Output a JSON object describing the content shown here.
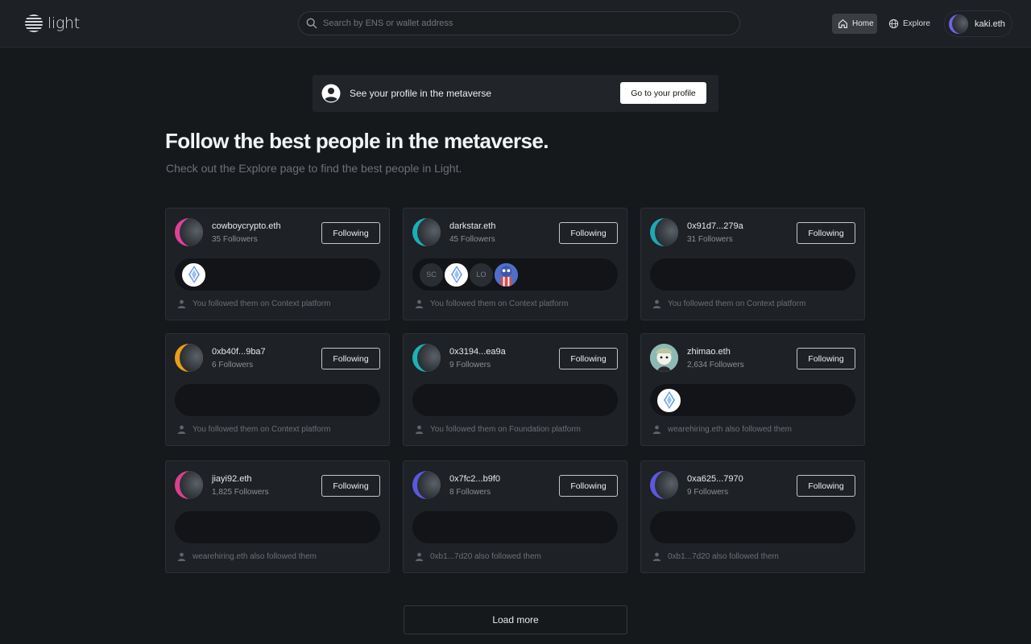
{
  "header": {
    "logo_text": "light",
    "search_placeholder": "Search by ENS or wallet address",
    "nav": {
      "home": "Home",
      "explore": "Explore",
      "user": "kaki.eth"
    }
  },
  "banner": {
    "text": "See your profile in the metaverse",
    "button": "Go to your profile"
  },
  "main": {
    "title": "Follow the best people in the metaverse.",
    "subtitle": "Check out the Explore page to find the best people in Light."
  },
  "cards": [
    {
      "name": "cowboycrypto.eth",
      "followers": "35 Followers",
      "button": "Following",
      "accent": "#e0409a",
      "mini": [
        "ens"
      ],
      "note": "You followed them on Context platform"
    },
    {
      "name": "darkstar.eth",
      "followers": "45 Followers",
      "button": "Following",
      "accent": "#18b0b8",
      "mini": [
        "SC",
        "ens",
        "LO",
        "sq"
      ],
      "note": "You followed them on Context platform"
    },
    {
      "name": "0x91d7...279a",
      "followers": "31 Followers",
      "button": "Following",
      "accent": "#1fa7b5",
      "mini": [],
      "note": "You followed them on Context platform"
    },
    {
      "name": "0xb40f...9ba7",
      "followers": "6 Followers",
      "button": "Following",
      "accent": "#e8a018",
      "mini": [],
      "note": "You followed them on Context platform"
    },
    {
      "name": "0x3194...ea9a",
      "followers": "9 Followers",
      "button": "Following",
      "accent": "#1cb3b3",
      "mini": [],
      "note": "You followed them on Foundation platform"
    },
    {
      "name": "zhimao.eth",
      "followers": "2,634 Followers",
      "button": "Following",
      "accent": "photo",
      "mini": [
        "ens"
      ],
      "note": "wearehiring.eth also followed them"
    },
    {
      "name": "jiayi92.eth",
      "followers": "1,825 Followers",
      "button": "Following",
      "accent": "#d9408e",
      "mini": [],
      "note": "wearehiring.eth also followed them"
    },
    {
      "name": "0x7fc2...b9f0",
      "followers": "8 Followers",
      "button": "Following",
      "accent": "#5a57e0",
      "mini": [],
      "note": "0xb1...7d20 also followed them"
    },
    {
      "name": "0xa625...7970",
      "followers": "9 Followers",
      "button": "Following",
      "accent": "#5c58de",
      "mini": [],
      "note": "0xb1...7d20 also followed them"
    }
  ],
  "load_more": "Load more",
  "colors": {
    "background": "#16191c",
    "card": "#1e2125",
    "user_accent": "#6c63e8"
  }
}
